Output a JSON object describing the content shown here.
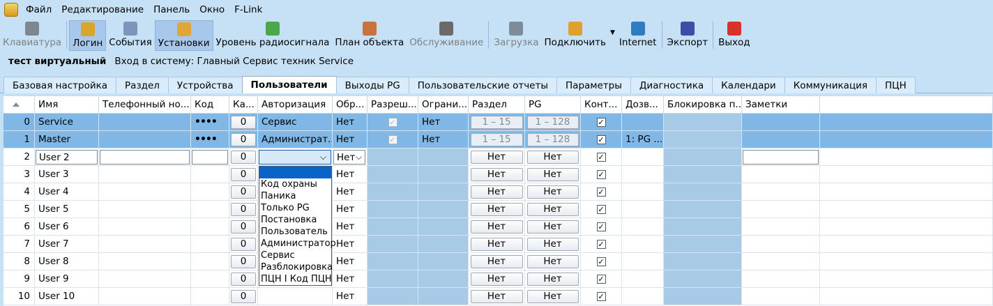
{
  "menu": [
    "Файл",
    "Редактирование",
    "Панель",
    "Окно",
    "F-Link"
  ],
  "toolbar": [
    {
      "label": "Клавиатура",
      "icon": "keypad-icon",
      "state": "dim",
      "color": "#7d8792"
    },
    {
      "label": "Логин",
      "icon": "login-icon",
      "state": "active",
      "color": "#d9a52b"
    },
    {
      "label": "События",
      "icon": "events-icon",
      "state": "normal",
      "color": "#7a96b8"
    },
    {
      "label": "Установки",
      "icon": "settings-icon",
      "state": "active",
      "color": "#e0a63a"
    },
    {
      "label": "Уровень радиосигнала",
      "icon": "signal-icon",
      "state": "normal",
      "color": "#4aa84a"
    },
    {
      "label": "План объекта",
      "icon": "house-icon",
      "state": "normal",
      "color": "#c8733c"
    },
    {
      "label": "Обслуживание",
      "icon": "service-icon",
      "state": "dim",
      "color": "#6a6a6a"
    },
    {
      "label": "Загрузка",
      "icon": "download-icon",
      "state": "dim",
      "color": "#7e8c9a"
    },
    {
      "label": "Подключить",
      "icon": "connect-icon",
      "state": "normal",
      "color": "#e0a030"
    },
    {
      "label": "Internet",
      "icon": "globe-icon",
      "state": "normal",
      "color": "#2f7cc0"
    },
    {
      "label": "Экспорт",
      "icon": "save-icon",
      "state": "normal",
      "color": "#3b4fa6"
    },
    {
      "label": "Выход",
      "icon": "power-icon",
      "state": "normal",
      "color": "#d8322c"
    }
  ],
  "info": {
    "panel": "тест виртуальный",
    "login": "Вход в систему: Главный Сервис техник Service"
  },
  "tabs": [
    "Базовая настройка",
    "Раздел",
    "Устройства",
    "Пользователи",
    "Выходы PG",
    "Пользовательские отчеты",
    "Параметры",
    "Диагностика",
    "Календари",
    "Коммуникация",
    "ПЦН"
  ],
  "selected_tab": "Пользователи",
  "columns": [
    "Имя",
    "Телефонный но...",
    "Код",
    "Ка...",
    "Авторизация",
    "Обр...",
    "Разреш...",
    "Ограни...",
    "Раздел",
    "PG",
    "Конт...",
    "Дозв...",
    "Блокировка п...",
    "Заметки"
  ],
  "rows": [
    {
      "idx": "0",
      "name": "Service",
      "code": "••••",
      "card": "0",
      "auth": "Сервис",
      "obr": "Нет",
      "allow": "✓",
      "limit": "Нет",
      "area": "1 – 15",
      "pg": "1 – 128",
      "ctrl": "✓",
      "dozv": "",
      "block": "",
      "notes": ""
    },
    {
      "idx": "1",
      "name": "Master",
      "code": "••••",
      "card": "0",
      "auth": "Администрат...",
      "obr": "Нет",
      "allow": "✓",
      "limit": "Нет",
      "area": "1 – 15",
      "pg": "1 – 128",
      "ctrl": "✓",
      "dozv": "1: PG ...",
      "block": "",
      "notes": ""
    },
    {
      "idx": "2",
      "name": "User 2",
      "code": "",
      "card": "0",
      "auth": "",
      "obr": "Нет",
      "allow": "",
      "limit": "",
      "area": "Нет",
      "pg": "Нет",
      "ctrl": "✓",
      "dozv": "",
      "block": "",
      "notes": ""
    },
    {
      "idx": "3",
      "name": "User 3",
      "code": "",
      "card": "0",
      "auth": "",
      "obr": "Нет",
      "allow": "",
      "limit": "",
      "area": "Нет",
      "pg": "Нет",
      "ctrl": "✓",
      "dozv": "",
      "block": "",
      "notes": ""
    },
    {
      "idx": "4",
      "name": "User 4",
      "code": "",
      "card": "0",
      "auth": "",
      "obr": "Нет",
      "allow": "",
      "limit": "",
      "area": "Нет",
      "pg": "Нет",
      "ctrl": "✓",
      "dozv": "",
      "block": "",
      "notes": ""
    },
    {
      "idx": "5",
      "name": "User 5",
      "code": "",
      "card": "0",
      "auth": "",
      "obr": "Нет",
      "allow": "",
      "limit": "",
      "area": "Нет",
      "pg": "Нет",
      "ctrl": "✓",
      "dozv": "",
      "block": "",
      "notes": ""
    },
    {
      "idx": "6",
      "name": "User 6",
      "code": "",
      "card": "0",
      "auth": "",
      "obr": "Нет",
      "allow": "",
      "limit": "",
      "area": "Нет",
      "pg": "Нет",
      "ctrl": "✓",
      "dozv": "",
      "block": "",
      "notes": ""
    },
    {
      "idx": "7",
      "name": "User 7",
      "code": "",
      "card": "0",
      "auth": "",
      "obr": "Нет",
      "allow": "",
      "limit": "",
      "area": "Нет",
      "pg": "Нет",
      "ctrl": "✓",
      "dozv": "",
      "block": "",
      "notes": ""
    },
    {
      "idx": "8",
      "name": "User 8",
      "code": "",
      "card": "0",
      "auth": "",
      "obr": "Нет",
      "allow": "",
      "limit": "",
      "area": "Нет",
      "pg": "Нет",
      "ctrl": "✓",
      "dozv": "",
      "block": "",
      "notes": ""
    },
    {
      "idx": "9",
      "name": "User 9",
      "code": "",
      "card": "0",
      "auth": "",
      "obr": "Нет",
      "allow": "",
      "limit": "",
      "area": "Нет",
      "pg": "Нет",
      "ctrl": "✓",
      "dozv": "",
      "block": "",
      "notes": ""
    },
    {
      "idx": "10",
      "name": "User 10",
      "code": "",
      "card": "0",
      "auth": "",
      "obr": "Нет",
      "allow": "",
      "limit": "",
      "area": "Нет",
      "pg": "Нет",
      "ctrl": "✓",
      "dozv": "",
      "block": "",
      "notes": ""
    }
  ],
  "auth_dropdown": {
    "options": [
      "Код охраны",
      "Паника",
      "Только PG",
      "Постановка",
      "Пользователь",
      "Администратор",
      "Сервис",
      "Разблокировка",
      "ПЦН I Код ПЦН"
    ]
  },
  "obr_dropdown_value": "Нет"
}
